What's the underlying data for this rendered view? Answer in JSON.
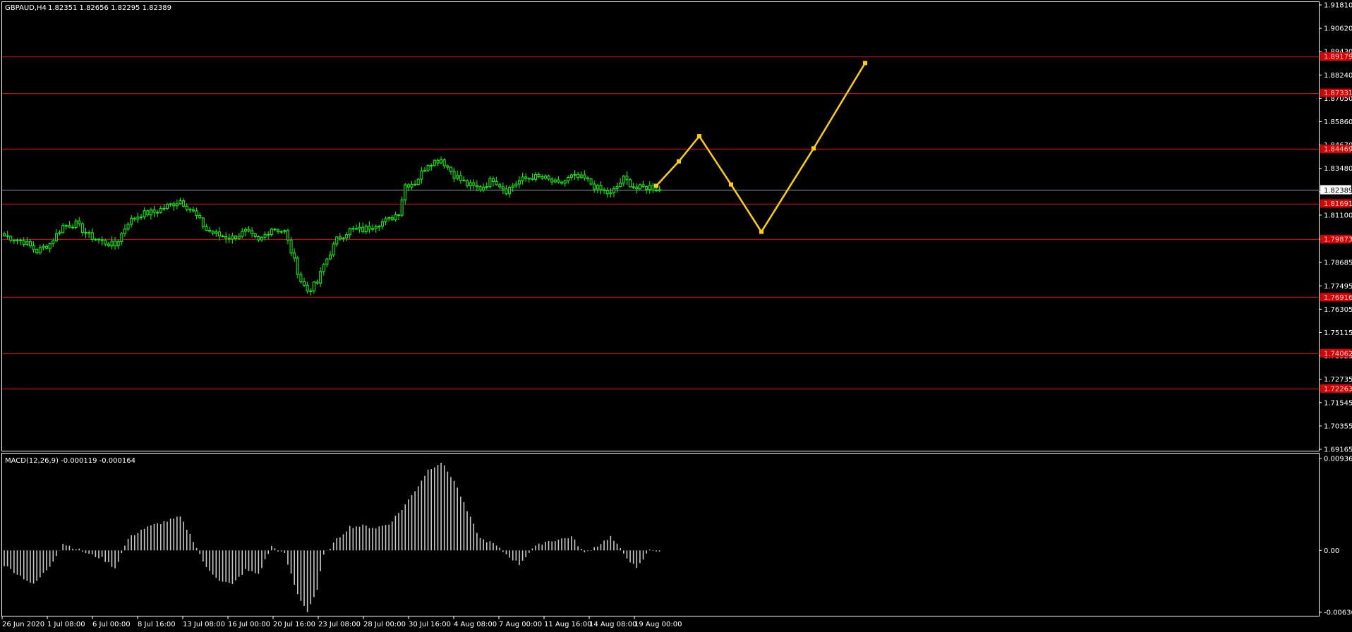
{
  "header": {
    "symbol": "GBPAUD,H4",
    "ohlc": "1.82351 1.82656 1.82295 1.82389"
  },
  "indicator": {
    "label": "MACD(12,26,9) -0.000119 -0.000164",
    "scale": [
      "0.009368",
      "0.00",
      "-0.006304"
    ]
  },
  "price_scale": [
    "1.91810",
    "1.90620",
    "1.89430",
    "1.88240",
    "1.87050",
    "1.85860",
    "1.84670",
    "1.83480",
    "1.82290",
    "1.81100",
    "1.79875",
    "1.78685",
    "1.77495",
    "1.76305",
    "1.75115",
    "1.73925",
    "1.72735",
    "1.71545",
    "1.70355",
    "1.69165"
  ],
  "current_price": "1.82389",
  "level_tags": [
    "1.89179",
    "1.87331",
    "1.84469",
    "1.81691",
    "1.79873",
    "1.76916",
    "1.74062",
    "1.72263"
  ],
  "time_labels": [
    "26 Jun 2020",
    "1 Jul 08:00",
    "6 Jul 00:00",
    "8 Jul 16:00",
    "13 Jul 08:00",
    "16 Jul 00:00",
    "20 Jul 16:00",
    "23 Jul 08:00",
    "28 Jul 00:00",
    "30 Jul 16:00",
    "4 Aug 08:00",
    "7 Aug 00:00",
    "11 Aug 16:00",
    "14 Aug 08:00",
    "19 Aug 00:00"
  ],
  "colors": {
    "background": "#000000",
    "bull_candle": "#00ff00",
    "bear_candle": "#ffffff",
    "level_line": "#d80000",
    "current_line": "#8a9aa8",
    "forecast": "#ffd000",
    "histogram": "#c8c8c8",
    "axis": "#ffffff"
  },
  "chart_data": {
    "type": "candlestick",
    "price_range": [
      1.69165,
      1.9181
    ],
    "horizontal_levels": [
      1.89179,
      1.87331,
      1.84469,
      1.81691,
      1.79873,
      1.76916,
      1.74062,
      1.72263
    ],
    "current_price": 1.82389,
    "close_path": [
      [
        0,
        1.8005
      ],
      [
        6,
        1.7975
      ],
      [
        10,
        1.7925
      ],
      [
        14,
        1.7965
      ],
      [
        18,
        1.8055
      ],
      [
        22,
        1.8065
      ],
      [
        26,
        1.8005
      ],
      [
        30,
        1.7975
      ],
      [
        34,
        1.7955
      ],
      [
        38,
        1.8075
      ],
      [
        42,
        1.8115
      ],
      [
        46,
        1.8125
      ],
      [
        50,
        1.8155
      ],
      [
        54,
        1.8185
      ],
      [
        58,
        1.8125
      ],
      [
        62,
        1.8035
      ],
      [
        66,
        1.8005
      ],
      [
        70,
        1.7995
      ],
      [
        74,
        1.8025
      ],
      [
        78,
        1.7975
      ],
      [
        82,
        1.8045
      ],
      [
        86,
        1.8025
      ],
      [
        88,
        1.7925
      ],
      [
        91,
        1.7775
      ],
      [
        93,
        1.7725
      ],
      [
        96,
        1.7765
      ],
      [
        98,
        1.7855
      ],
      [
        102,
        1.7985
      ],
      [
        106,
        1.8035
      ],
      [
        110,
        1.8035
      ],
      [
        114,
        1.8065
      ],
      [
        118,
        1.8085
      ],
      [
        121,
        1.8125
      ],
      [
        123,
        1.8265
      ],
      [
        126,
        1.8275
      ],
      [
        130,
        1.8375
      ],
      [
        134,
        1.8395
      ],
      [
        138,
        1.8315
      ],
      [
        142,
        1.8265
      ],
      [
        146,
        1.8245
      ],
      [
        150,
        1.8295
      ],
      [
        154,
        1.8235
      ],
      [
        158,
        1.8285
      ],
      [
        162,
        1.8305
      ],
      [
        166,
        1.8295
      ],
      [
        170,
        1.8265
      ],
      [
        174,
        1.8305
      ],
      [
        178,
        1.8295
      ],
      [
        182,
        1.8245
      ],
      [
        186,
        1.8215
      ],
      [
        190,
        1.8295
      ],
      [
        194,
        1.8245
      ],
      [
        198,
        1.8255
      ],
      [
        201,
        1.8239
      ]
    ],
    "candle_count": 202,
    "forecast_path": [
      [
        1.82591,
        0
      ],
      [
        1.83837,
        1
      ],
      [
        1.85121,
        2
      ],
      [
        1.8266,
        3
      ],
      [
        1.8025,
        4
      ],
      [
        1.845,
        5
      ],
      [
        1.8885,
        6
      ]
    ],
    "macd_range": [
      -0.006304,
      0.009368
    ],
    "macd_path": [
      [
        0,
        -0.0015
      ],
      [
        9,
        -0.0035
      ],
      [
        14,
        -0.0016
      ],
      [
        18,
        0.0007
      ],
      [
        22,
        0.0002
      ],
      [
        26,
        -0.0004
      ],
      [
        30,
        -0.0008
      ],
      [
        34,
        -0.0018
      ],
      [
        38,
        0.0012
      ],
      [
        42,
        0.0021
      ],
      [
        46,
        0.0026
      ],
      [
        50,
        0.003
      ],
      [
        54,
        0.0034
      ],
      [
        58,
        0.001
      ],
      [
        62,
        -0.0018
      ],
      [
        66,
        -0.003
      ],
      [
        70,
        -0.0035
      ],
      [
        74,
        -0.002
      ],
      [
        78,
        -0.0024
      ],
      [
        82,
        0.0004
      ],
      [
        86,
        -0.0004
      ],
      [
        90,
        -0.0045
      ],
      [
        93,
        -0.0062
      ],
      [
        96,
        -0.004
      ],
      [
        98,
        -0.0005
      ],
      [
        102,
        0.0011
      ],
      [
        106,
        0.0024
      ],
      [
        110,
        0.0025
      ],
      [
        114,
        0.0023
      ],
      [
        118,
        0.0027
      ],
      [
        122,
        0.0042
      ],
      [
        126,
        0.0061
      ],
      [
        130,
        0.0082
      ],
      [
        134,
        0.009
      ],
      [
        138,
        0.0071
      ],
      [
        142,
        0.004
      ],
      [
        146,
        0.0012
      ],
      [
        150,
        0.0007
      ],
      [
        154,
        -0.0004
      ],
      [
        158,
        -0.0014
      ],
      [
        162,
        0.0002
      ],
      [
        166,
        0.0009
      ],
      [
        170,
        0.0011
      ],
      [
        174,
        0.0014
      ],
      [
        178,
        -0.0003
      ],
      [
        182,
        0.0005
      ],
      [
        186,
        0.0014
      ],
      [
        190,
        -0.0003
      ],
      [
        194,
        -0.0019
      ],
      [
        198,
        0.0001
      ],
      [
        201,
        -0.0001
      ]
    ]
  }
}
